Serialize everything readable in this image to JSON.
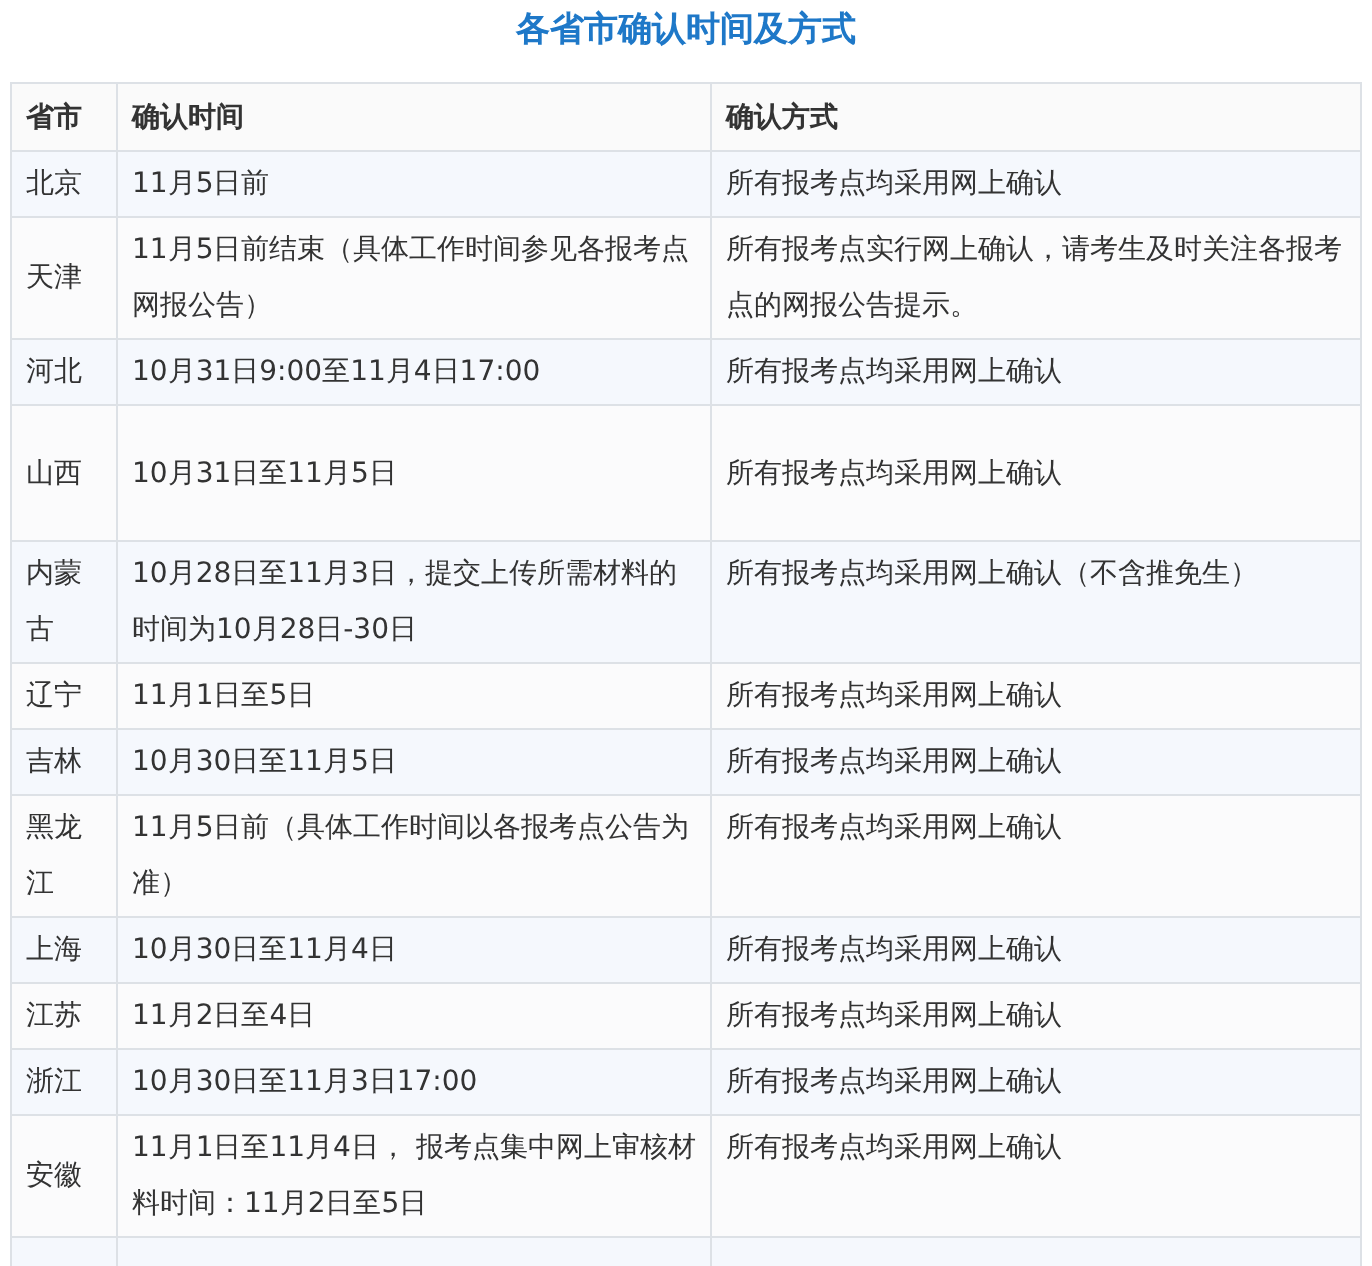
{
  "title": "各省市确认时间及方式",
  "table": {
    "columns": [
      "省市",
      "确认时间",
      "确认方式"
    ],
    "rows": [
      {
        "province": "北京",
        "time": "11月5日前",
        "method": "所有报考点均采用网上确认"
      },
      {
        "province": "天津",
        "time": "11月5日前结束（具体工作时间参见各报考点网报公告）",
        "method": "所有报考点实行网上确认，请考生及时关注各报考点的网报公告提示。"
      },
      {
        "province": "河北",
        "time": "10月31日9:00至11月4日17:00",
        "method": "所有报考点均采用网上确认"
      },
      {
        "province": "山西",
        "time": "10月31日至11月5日",
        "method": "所有报考点均采用网上确认"
      },
      {
        "province": "内蒙古",
        "time": "10月28日至11月3日，提交上传所需材料的时间为10月28日-30日",
        "method": "所有报考点均采用网上确认（不含推免生）"
      },
      {
        "province": "辽宁",
        "time": "11月1日至5日",
        "method": "所有报考点均采用网上确认"
      },
      {
        "province": "吉林",
        "time": "10月30日至11月5日",
        "method": "所有报考点均采用网上确认"
      },
      {
        "province": "黑龙江",
        "time": "11月5日前（具体工作时间以各报考点公告为准）",
        "method": "所有报考点均采用网上确认"
      },
      {
        "province": "上海",
        "time": "10月30日至11月4日",
        "method": "所有报考点均采用网上确认"
      },
      {
        "province": "江苏",
        "time": "11月2日至4日",
        "method": "所有报考点均采用网上确认"
      },
      {
        "province": "浙江",
        "time": "10月30日至11月3日17:00",
        "method": "所有报考点均采用网上确认"
      },
      {
        "province": "安徽",
        "time": "11月1日至11月4日， 报考点集中网上审核材料时间：11月2日至5日",
        "method": "所有报考点均采用网上确认"
      }
    ]
  }
}
